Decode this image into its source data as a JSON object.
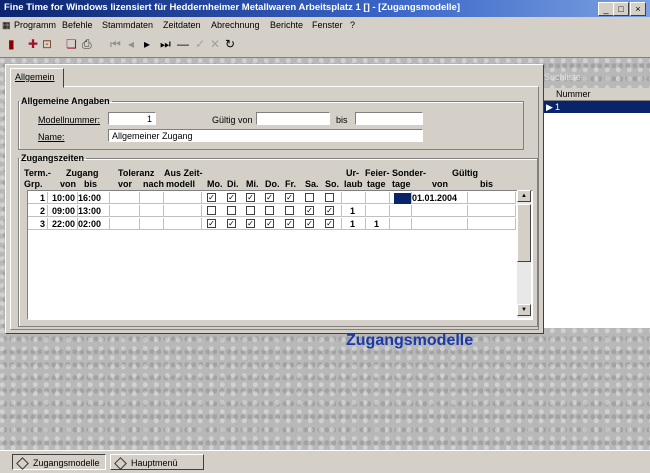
{
  "window": {
    "title": "Fine Time for Windows lizensiert für Heddernheimer Metallwaren     Arbeitsplatz 1 []          - [Zugangsmodelle]",
    "controls": [
      "_",
      "□",
      "×"
    ]
  },
  "menu": [
    "Programm",
    "Befehle",
    "Stammdaten",
    "Zeitdaten",
    "Abrechnung",
    "Berichte",
    "Fenster",
    "?"
  ],
  "toolbar_icons": [
    "exit-icon",
    "new-record-icon",
    "open-icon",
    "copy-icon",
    "print-icon",
    "first-record-icon",
    "prev-record-icon",
    "next-record-icon",
    "last-record-icon",
    "delete-record-icon",
    "confirm-icon",
    "cancel-icon",
    "refresh-icon"
  ],
  "tab": {
    "label": "Allgemein"
  },
  "allgemeine_angaben": {
    "legend": "Allgemeine Angaben",
    "modellnummer_label": "Modellnummer:",
    "modellnummer_value": "1",
    "gueltig_von_label": "Gültig von",
    "gueltig_von_value": "",
    "bis_label": "bis",
    "bis_value": "",
    "name_label": "Name:",
    "name_value": "Allgemeiner Zugang"
  },
  "zugangszeiten": {
    "legend": "Zugangszeiten",
    "header_top": [
      "Term.-",
      "Zugang",
      "Toleranz",
      "Aus Zeit-",
      "Ur-",
      "Feier-",
      "Sonder-",
      "Gültig"
    ],
    "header_bottom": [
      "Grp.",
      "von",
      "bis",
      "vor",
      "nach",
      "modell",
      "Mo.",
      "Di.",
      "Mi.",
      "Do.",
      "Fr.",
      "Sa.",
      "So.",
      "laub",
      "tage",
      "tage",
      "von",
      "bis"
    ],
    "rows": [
      {
        "grp": "1",
        "von": "10:00",
        "bis": "16:00",
        "days": [
          true,
          true,
          true,
          true,
          true,
          false,
          false
        ],
        "urlaub": "",
        "feiertage": "",
        "sondertage": "",
        "gueltig_von": "01.01.2004",
        "gueltig_bis": ""
      },
      {
        "grp": "2",
        "von": "09:00",
        "bis": "13:00",
        "days": [
          false,
          false,
          false,
          false,
          false,
          true,
          true
        ],
        "urlaub": "1",
        "feiertage": "",
        "sondertage": "",
        "gueltig_von": "",
        "gueltig_bis": ""
      },
      {
        "grp": "3",
        "von": "22:00",
        "bis": "02:00",
        "days": [
          true,
          true,
          true,
          true,
          true,
          true,
          true
        ],
        "urlaub": "1",
        "feiertage": "1",
        "sondertage": "",
        "gueltig_von": "",
        "gueltig_bis": ""
      }
    ]
  },
  "suchliste": {
    "label": "Suchliste",
    "column": "Nummer",
    "rows": [
      "1"
    ]
  },
  "form_caption": "Zugangsmodelle",
  "taskbar": [
    {
      "label": "Zugangsmodelle",
      "active": true
    },
    {
      "label": "Hauptmenü",
      "active": false
    }
  ],
  "colors": {
    "titlebar": "#0a2470",
    "selection": "#0a246a",
    "caption": "#1a3aa8",
    "panel": "#d4d0c8"
  }
}
